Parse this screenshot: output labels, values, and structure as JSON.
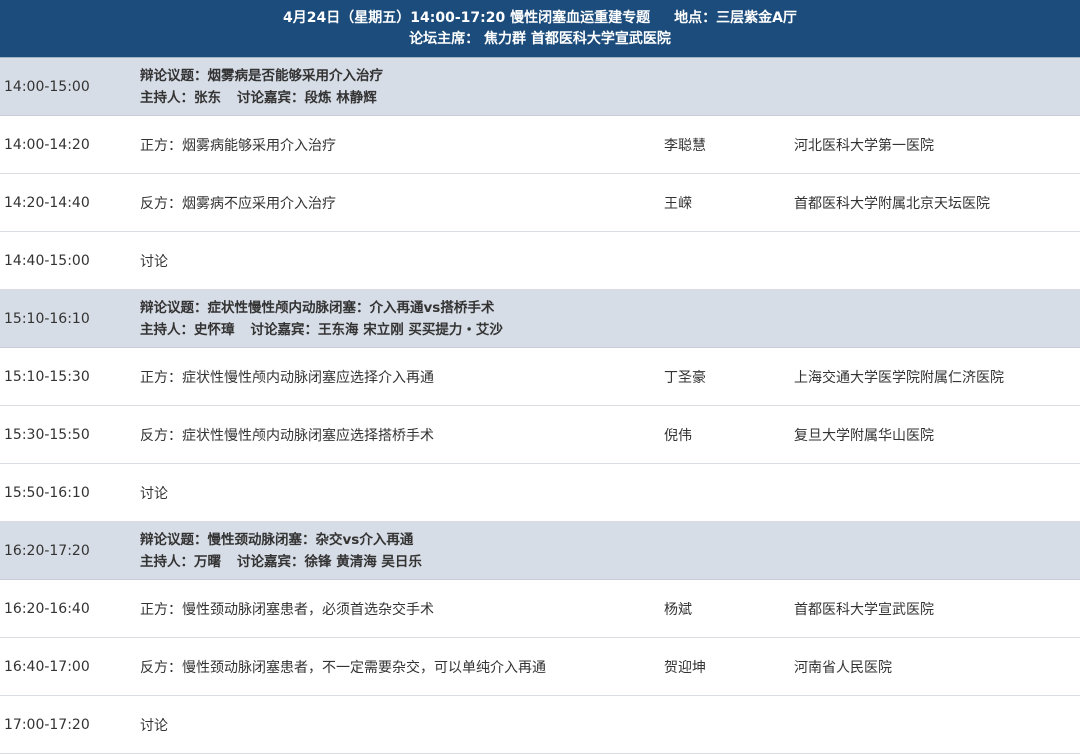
{
  "header": {
    "line1_date": "4月24日（星期五）14:00-17:20 慢性闭塞血运重建专题",
    "line1_location": "地点：三层紫金A厅",
    "line2": "论坛主席： 焦力群 首都医科大学宣武医院"
  },
  "sections": [
    {
      "time": "14:00-15:00",
      "topic": "辩论议题：烟雾病是否能够采用介入治疗",
      "host": "主持人：张东",
      "guests": "讨论嘉宾：段炼 林静辉",
      "items": [
        {
          "time": "14:00-14:20",
          "topic": "正方：烟雾病能够采用介入治疗",
          "speaker": "李聪慧",
          "org": "河北医科大学第一医院"
        },
        {
          "time": "14:20-14:40",
          "topic": "反方：烟雾病不应采用介入治疗",
          "speaker": "王嵘",
          "org": "首都医科大学附属北京天坛医院"
        },
        {
          "time": "14:40-15:00",
          "topic": "讨论",
          "speaker": "",
          "org": ""
        }
      ]
    },
    {
      "time": "15:10-16:10",
      "topic": "辩论议题：症状性慢性颅内动脉闭塞：介入再通vs搭桥手术",
      "host": "主持人：史怀璋",
      "guests": "讨论嘉宾：王东海 宋立刚 买买提力・艾沙",
      "items": [
        {
          "time": "15:10-15:30",
          "topic": "正方：症状性慢性颅内动脉闭塞应选择介入再通",
          "speaker": "丁圣豪",
          "org": "上海交通大学医学院附属仁济医院"
        },
        {
          "time": "15:30-15:50",
          "topic": "反方：症状性慢性颅内动脉闭塞应选择搭桥手术",
          "speaker": "倪伟",
          "org": "复旦大学附属华山医院"
        },
        {
          "time": "15:50-16:10",
          "topic": "讨论",
          "speaker": "",
          "org": ""
        }
      ]
    },
    {
      "time": "16:20-17:20",
      "topic": "辩论议题：慢性颈动脉闭塞：杂交vs介入再通",
      "host": "主持人：万曙",
      "guests": "讨论嘉宾：徐锋 黄清海 吴日乐",
      "items": [
        {
          "time": "16:20-16:40",
          "topic": "正方：慢性颈动脉闭塞患者，必须首选杂交手术",
          "speaker": "杨斌",
          "org": "首都医科大学宣武医院"
        },
        {
          "time": "16:40-17:00",
          "topic": "反方：慢性颈动脉闭塞患者，不一定需要杂交，可以单纯介入再通",
          "speaker": "贺迎坤",
          "org": "河南省人民医院"
        },
        {
          "time": "17:00-17:20",
          "topic": "讨论",
          "speaker": "",
          "org": ""
        }
      ]
    }
  ]
}
